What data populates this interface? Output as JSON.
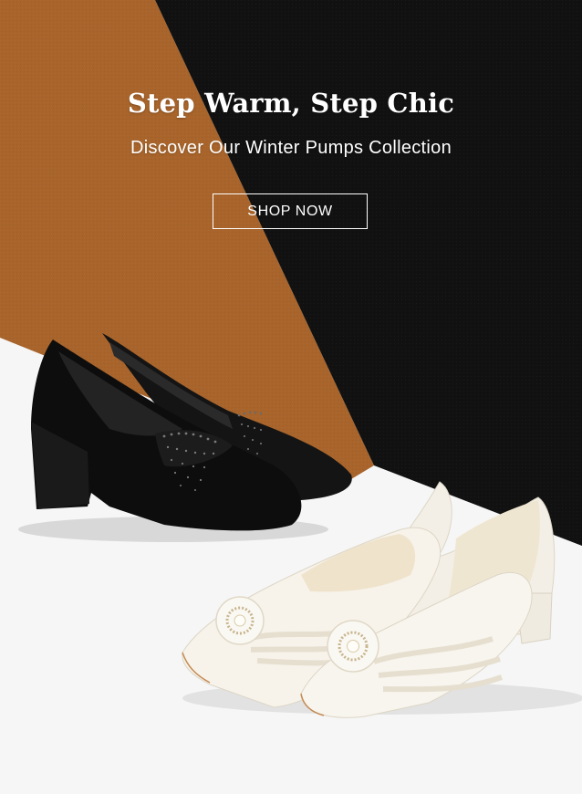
{
  "banner": {
    "title": "Step Warm, Step Chic",
    "subtitle": "Discover Our Winter Pumps Collection",
    "cta_label": "SHOP NOW"
  },
  "colors": {
    "tan": "#a8642b",
    "black": "#111111",
    "floor": "#f6f6f6",
    "text": "#ffffff",
    "ivory": "#f3efe6"
  },
  "products": [
    {
      "name": "black-suede-pump",
      "icon": "black-pump-image"
    },
    {
      "name": "ivory-pearl-pump",
      "icon": "ivory-pump-image"
    }
  ]
}
